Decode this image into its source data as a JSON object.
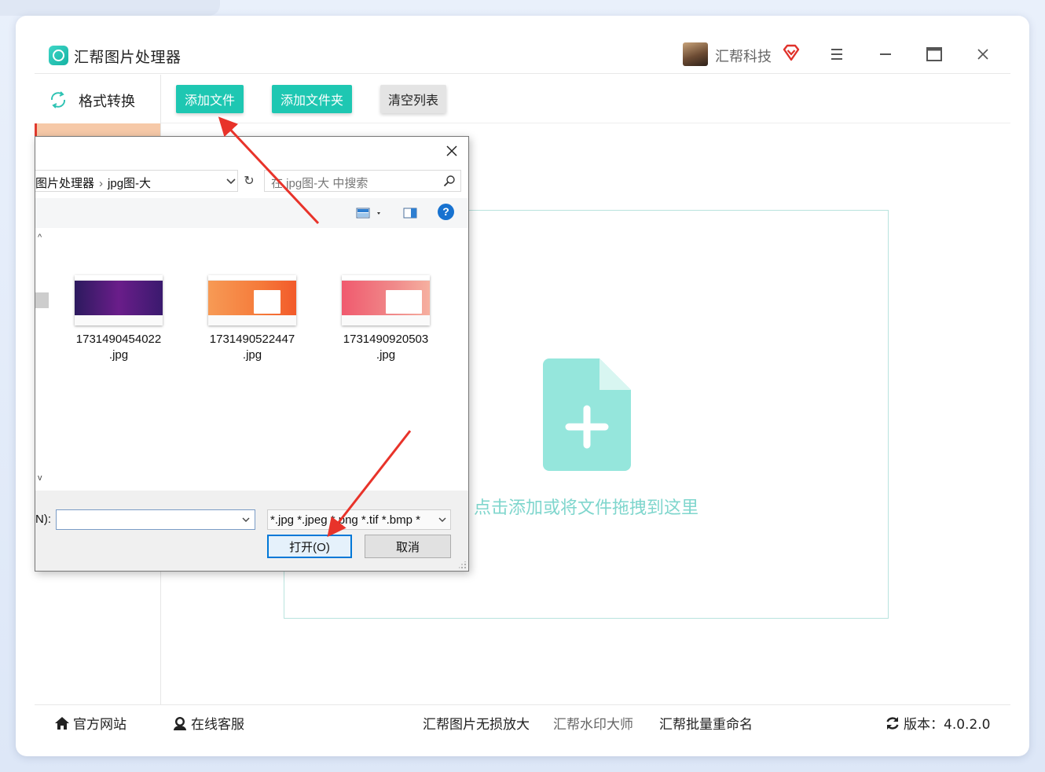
{
  "app": {
    "title": "汇帮图片处理器",
    "user_name": "汇帮科技"
  },
  "sidebar": {
    "items": [
      {
        "label": "格式转换",
        "active": true
      }
    ]
  },
  "toolbar": {
    "add_file_label": "添加文件",
    "add_folder_label": "添加文件夹",
    "clear_list_label": "清空列表"
  },
  "dropzone": {
    "hint": "点击添加或将文件拖拽到这里"
  },
  "dialog": {
    "breadcrumb": [
      "图片处理器",
      "jpg图-大"
    ],
    "search_placeholder": "在 jpg图-大 中搜索",
    "files": [
      {
        "name_line1": "1731490454022",
        "name_line2": ".jpg"
      },
      {
        "name_line1": "1731490522447",
        "name_line2": ".jpg"
      },
      {
        "name_line1": "1731490920503",
        "name_line2": ".jpg"
      }
    ],
    "filename_label": "N):",
    "filename_value": "",
    "filter_value": "*.jpg *.jpeg *.png *.tif *.bmp *",
    "open_label": "打开(O)",
    "cancel_label": "取消"
  },
  "footer": {
    "official_site": "官方网站",
    "online_service": "在线客服",
    "link1": "汇帮图片无损放大",
    "link2": "汇帮水印大师",
    "link3": "汇帮批量重命名",
    "version": "版本：4.0.2.0"
  },
  "colors": {
    "accent": "#1ec7b2",
    "dropzone_text": "#7fd6cd",
    "annotation_arrow": "#e8332a"
  }
}
